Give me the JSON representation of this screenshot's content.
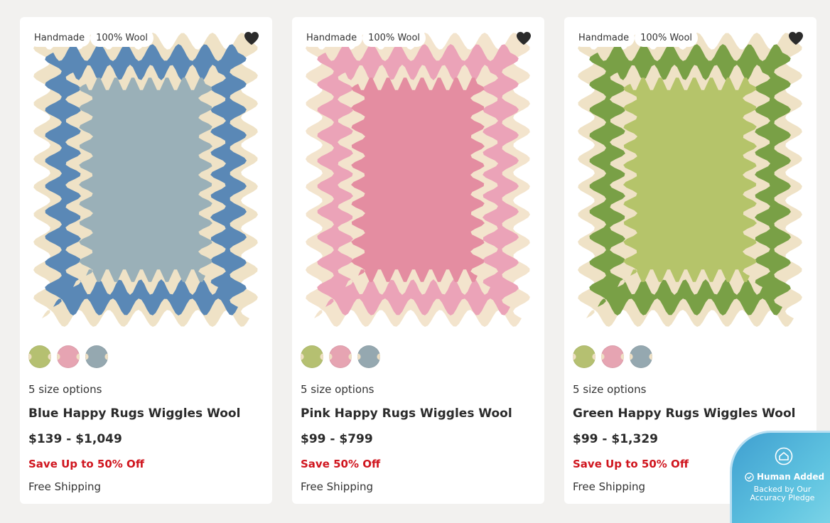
{
  "products": [
    {
      "badges": [
        "Handmade",
        "100% Wool"
      ],
      "colors": {
        "outer": "#5a88b6",
        "inner": "#9ab0b8",
        "border": "#efe2c6"
      },
      "swatches": [
        {
          "name": "green",
          "color": "#b5c071"
        },
        {
          "name": "pink",
          "color": "#e6a4b2"
        },
        {
          "name": "blue",
          "color": "#95a8b0"
        }
      ],
      "size_options": "5 size options",
      "title": "Blue Happy Rugs Wiggles Wool",
      "price": "$139 - $1,049",
      "sale": "Save Up to 50% Off",
      "shipping": "Free Shipping"
    },
    {
      "badges": [
        "Handmade",
        "100% Wool"
      ],
      "colors": {
        "outer": "#eba3b8",
        "inner": "#e48da1",
        "border": "#f3e4cd"
      },
      "swatches": [
        {
          "name": "green",
          "color": "#b5c071"
        },
        {
          "name": "pink",
          "color": "#e6a4b2"
        },
        {
          "name": "blue",
          "color": "#95a8b0"
        }
      ],
      "size_options": "5 size options",
      "title": "Pink Happy Rugs Wiggles Wool",
      "price": "$99 - $799",
      "sale": "Save 50% Off",
      "shipping": "Free Shipping"
    },
    {
      "badges": [
        "Handmade",
        "100% Wool"
      ],
      "colors": {
        "outer": "#79a046",
        "inner": "#b5c46a",
        "border": "#efe2c6"
      },
      "swatches": [
        {
          "name": "green",
          "color": "#b5c071"
        },
        {
          "name": "pink",
          "color": "#e6a4b2"
        },
        {
          "name": "blue",
          "color": "#95a8b0"
        }
      ],
      "size_options": "5 size options",
      "title": "Green Happy Rugs Wiggles Wool",
      "price": "$99 - $1,329",
      "sale": "Save Up to 50% Off",
      "shipping": "Free Shipping"
    }
  ],
  "pledge": {
    "line1": "Human Added",
    "line2": "Backed by Our Accuracy Pledge"
  },
  "icons": {
    "favorite": "heart-icon",
    "pledge": "home-badge-icon",
    "check": "check-circle-icon"
  },
  "accent": {
    "sale_red": "#d0161f"
  }
}
